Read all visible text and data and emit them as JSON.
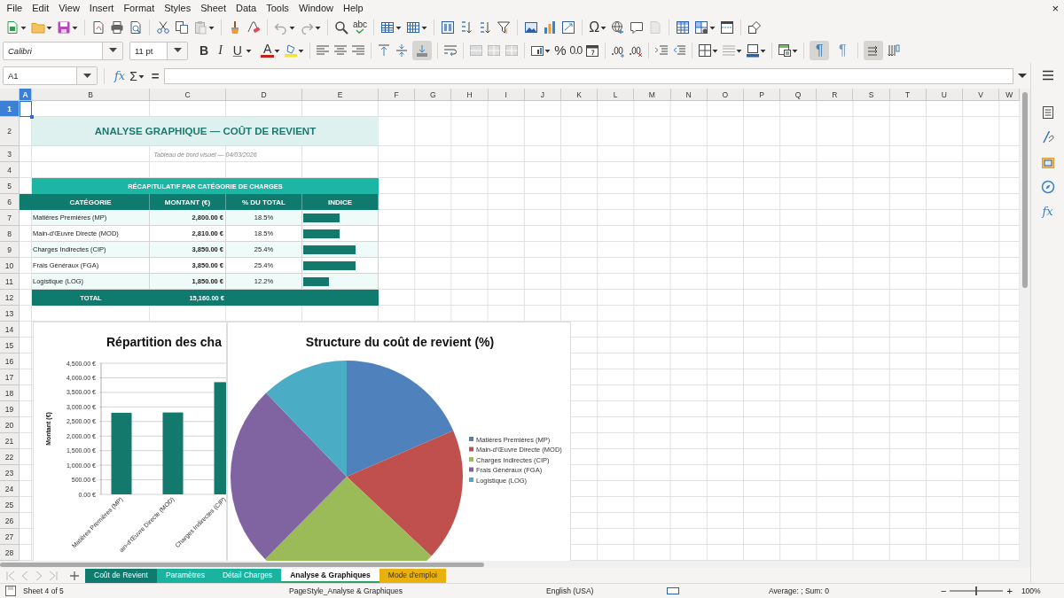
{
  "menu": [
    "File",
    "Edit",
    "View",
    "Insert",
    "Format",
    "Styles",
    "Sheet",
    "Data",
    "Tools",
    "Window",
    "Help"
  ],
  "close_glyph": "×",
  "standard_toolbar": {
    "spelling_glyph": "abc",
    "special_character_glyph": "Ω"
  },
  "formatting_toolbar": {
    "font_name": "Calibri",
    "font_size": "11 pt",
    "bold_glyph": "B",
    "italic_glyph": "I",
    "underline_glyph": "U",
    "font_color_glyph": "A",
    "percent_glyph": "%",
    "number_glyph": "0.0",
    "ltr_glyph": "¶",
    "rtl_glyph": "¶",
    "toggles": {
      "align_bottom": {
        "selected": true
      },
      "left_to_right": {
        "selected": true
      },
      "text_orientation": {
        "selected": true
      }
    }
  },
  "formula_bar": {
    "cell_ref": "A1",
    "function_glyph": "fx",
    "sum_glyph": "Σ",
    "equals_glyph": "="
  },
  "sidebar": {
    "function_glyph": "fx"
  },
  "columns": [
    {
      "label": "A",
      "selected": true
    },
    {
      "label": "B",
      "selected": false
    },
    {
      "label": "C",
      "selected": false
    },
    {
      "label": "D",
      "selected": false
    },
    {
      "label": "E",
      "selected": false
    },
    {
      "label": "F",
      "selected": false
    },
    {
      "label": "G",
      "selected": false
    },
    {
      "label": "H",
      "selected": false
    },
    {
      "label": "I",
      "selected": false
    },
    {
      "label": "J",
      "selected": false
    },
    {
      "label": "K",
      "selected": false
    },
    {
      "label": "L",
      "selected": false
    },
    {
      "label": "M",
      "selected": false
    },
    {
      "label": "N",
      "selected": false
    },
    {
      "label": "O",
      "selected": false
    },
    {
      "label": "P",
      "selected": false
    },
    {
      "label": "Q",
      "selected": false
    },
    {
      "label": "R",
      "selected": false
    },
    {
      "label": "S",
      "selected": false
    },
    {
      "label": "T",
      "selected": false
    },
    {
      "label": "U",
      "selected": false
    },
    {
      "label": "V",
      "selected": false
    },
    {
      "label": "W",
      "selected": false
    }
  ],
  "rows": [
    {
      "label": "1",
      "selected": true
    },
    {
      "label": "2",
      "selected": false
    },
    {
      "label": "3",
      "selected": false
    },
    {
      "label": "4",
      "selected": false
    },
    {
      "label": "5",
      "selected": false
    },
    {
      "label": "6",
      "selected": false
    },
    {
      "label": "7",
      "selected": false
    },
    {
      "label": "8",
      "selected": false
    },
    {
      "label": "9",
      "selected": false
    },
    {
      "label": "10",
      "selected": false
    },
    {
      "label": "11",
      "selected": false
    },
    {
      "label": "12",
      "selected": false
    },
    {
      "label": "13",
      "selected": false
    },
    {
      "label": "14",
      "selected": false
    },
    {
      "label": "15",
      "selected": false
    },
    {
      "label": "16",
      "selected": false
    },
    {
      "label": "17",
      "selected": false
    },
    {
      "label": "18",
      "selected": false
    },
    {
      "label": "19",
      "selected": false
    },
    {
      "label": "20",
      "selected": false
    },
    {
      "label": "21",
      "selected": false
    },
    {
      "label": "22",
      "selected": false
    },
    {
      "label": "23",
      "selected": false
    },
    {
      "label": "24",
      "selected": false
    },
    {
      "label": "25",
      "selected": false
    },
    {
      "label": "26",
      "selected": false
    },
    {
      "label": "27",
      "selected": false
    },
    {
      "label": "28",
      "selected": false
    }
  ],
  "title": "ANALYSE GRAPHIQUE — COÛT DE REVIENT",
  "subtitle": "Tableau de bord visuel — 04/03/2026",
  "table": {
    "caption": "RÉCAPITULATIF PAR CATÉGORIE DE CHARGES",
    "columns": [
      "CATÉGORIE",
      "MONTANT (€)",
      "% DU TOTAL",
      "INDICE"
    ],
    "rows": [
      {
        "category": "Matières Premières (MP)",
        "amount": "2,800.00 €",
        "share": "18.5%",
        "level": 0.49
      },
      {
        "category": "Main-d'Œuvre Directe (MOD)",
        "amount": "2,810.00 €",
        "share": "18.5%",
        "level": 0.49
      },
      {
        "category": "Charges Indirectes (CIP)",
        "amount": "3,850.00 €",
        "share": "25.4%",
        "level": 0.7
      },
      {
        "category": "Frais Généraux (FGA)",
        "amount": "3,850.00 €",
        "share": "25.4%",
        "level": 0.7
      },
      {
        "category": "Logistique (LOG)",
        "amount": "1,850.00 €",
        "share": "12.2%",
        "level": 0.35
      }
    ],
    "total": {
      "label": "TOTAL",
      "amount": "15,160.00 €"
    }
  },
  "bar_chart": {
    "chart_data": {
      "type": "bar",
      "title": "Répartition des cha",
      "ylabel": "Montant (€)",
      "categories": [
        "Matières Premières (MP)",
        "ain-d'Œuvre Directe (MOD)",
        "Charges Indirectes (CIP)"
      ],
      "series": [
        {
          "color": "#13796c",
          "values": [
            2800,
            2810,
            3850
          ]
        }
      ],
      "grid": true,
      "ylim": [
        0,
        4500
      ],
      "yticks": [
        {
          "value": 0,
          "label": "0.00 €"
        },
        {
          "value": 500,
          "label": "500.00 €"
        },
        {
          "value": 1000,
          "label": "1,000.00 €"
        },
        {
          "value": 1500,
          "label": "1,500.00 €"
        },
        {
          "value": 2000,
          "label": "2,000.00 €"
        },
        {
          "value": 2500,
          "label": "2,500.00 €"
        },
        {
          "value": 3000,
          "label": "3,000.00 €"
        },
        {
          "value": 3500,
          "label": "3,500.00 €"
        },
        {
          "value": 4000,
          "label": "4,000.00 €"
        },
        {
          "value": 4500,
          "label": "4,500.00 €"
        }
      ]
    }
  },
  "pie_chart": {
    "chart_data": {
      "type": "pie",
      "title": "Structure du coût de revient (%)",
      "values": [
        18.5,
        18.5,
        25.4,
        25.4,
        12.2
      ]
    },
    "legend": [
      {
        "label": "Matières Premières (MP)",
        "color": "#4f81bd"
      },
      {
        "label": "Main-d'Œuvre Directe (MOD)",
        "color": "#c0504d"
      },
      {
        "label": "Charges Indirectes (CIP)",
        "color": "#9bbb59"
      },
      {
        "label": "Frais Généraux (FGA)",
        "color": "#8064a2"
      },
      {
        "label": "Logistique (LOG)",
        "color": "#4bacc6"
      }
    ]
  },
  "sheet_tabs": [
    {
      "label": "Coût de Revient",
      "color": "#0f7a6e",
      "selected": false
    },
    {
      "label": "Paramètres",
      "color": "#1ab3a0",
      "selected": false
    },
    {
      "label": "Détail Charges",
      "color": "#1ab3a0",
      "selected": false
    },
    {
      "label": "Analyse & Graphiques",
      "color": "#2ea06a",
      "selected": true
    },
    {
      "label": "Mode d'emploi",
      "color": "#e8b10d",
      "selected": false
    }
  ],
  "status_bar": {
    "sheet": "Sheet 4 of 5",
    "page_style": "PageStyle_Analyse & Graphiques",
    "language": "English (USA)",
    "summary": "Average: ; Sum: 0",
    "zoom_out_glyph": "−",
    "zoom_in_glyph": "+",
    "zoom": "100%",
    "zoom_slider": {
      "level": 0.5
    }
  }
}
